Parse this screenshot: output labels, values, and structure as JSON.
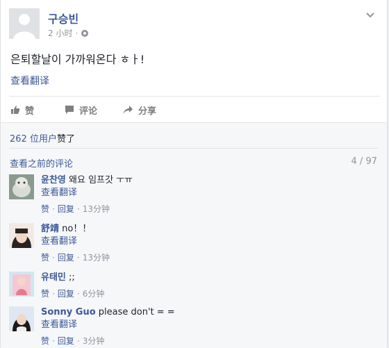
{
  "post": {
    "author": "구승빈",
    "time": "2 小时",
    "text": "은퇴할날이 가까워온다 ㅎㅏ!",
    "translate": "查看翻译"
  },
  "actions": {
    "like": "赞",
    "comment": "评论",
    "share": "分享"
  },
  "ufi": {
    "likes_count": "262 位用户",
    "likes_suffix": "赞了",
    "previous": "查看之前的评论",
    "count": "4 / 97"
  },
  "comments": [
    {
      "name": "윤찬영",
      "text": " 왜요 임프갓 ㅜㅠ",
      "translate": "查看翻译",
      "like": "赞",
      "reply": "回复",
      "time": "13分钟"
    },
    {
      "name": "舒靖",
      "text": " no！！",
      "translate": "查看翻译",
      "like": "赞",
      "reply": "回复",
      "time": "13分钟"
    },
    {
      "name": "유태민",
      "text": " ;;",
      "translate": "",
      "like": "赞",
      "reply": "回复",
      "time": "6分钟"
    },
    {
      "name": "Sonny Guo",
      "text": " please don't = =",
      "translate": "查看翻译",
      "like": "赞",
      "reply": "回复",
      "time": "3分钟"
    }
  ]
}
